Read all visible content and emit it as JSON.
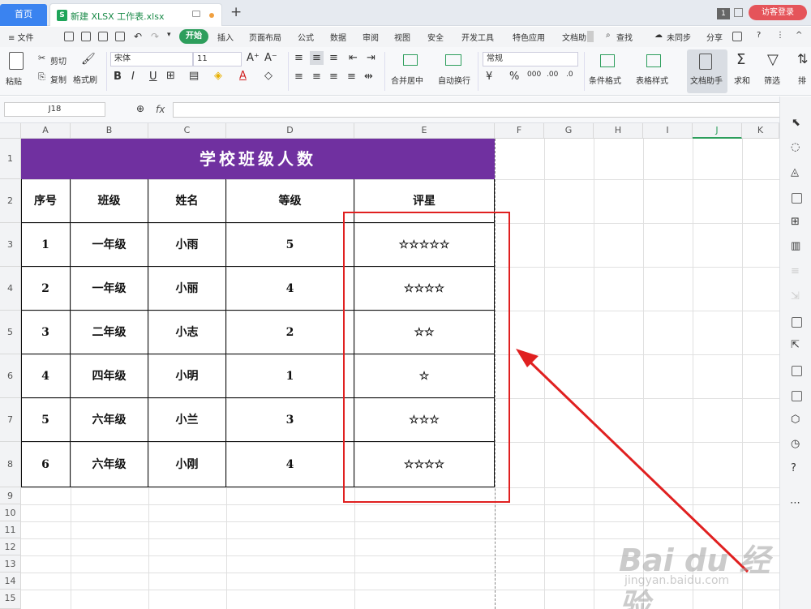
{
  "titlebar": {
    "home_tab": "首页",
    "file_icon": "S",
    "file_name": "新建 XLSX 工作表.xlsx",
    "new_tab": "+",
    "window_badge": "1",
    "login_button": "访客登录"
  },
  "menu": {
    "file": "≡ 文件",
    "start": "开始",
    "items": [
      "插入",
      "页面布局",
      "公式",
      "数据",
      "审阅",
      "视图",
      "安全",
      "开发工具",
      "特色应用",
      "文档助"
    ],
    "search": "查找",
    "sync": "未同步",
    "share": "分享",
    "help": "?",
    "more": "⋮"
  },
  "ribbon": {
    "paste": "粘贴",
    "cut": "剪切",
    "copy": "复制",
    "format_painter": "格式刷",
    "font_name": "宋体",
    "font_size": "11",
    "bold": "B",
    "italic": "I",
    "underline": "U",
    "number_format": "常规",
    "merge_center": "合并居中",
    "wrap_text": "自动换行",
    "percent": "%",
    "cond_format": "条件格式",
    "table_style": "表格样式",
    "doc_assistant": "文档助手",
    "sum": "求和",
    "filter": "筛选",
    "sort": "排"
  },
  "formula_bar": {
    "cell_ref": "J18",
    "fx_label": "fx",
    "content": ""
  },
  "sheet": {
    "columns": [
      "A",
      "B",
      "C",
      "D",
      "E",
      "F",
      "G",
      "H",
      "I",
      "J",
      "K"
    ],
    "rows": [
      "1",
      "2",
      "3",
      "4",
      "5",
      "6",
      "7",
      "8",
      "9",
      "10",
      "11",
      "12",
      "13",
      "14",
      "15"
    ],
    "title": "学校班级人数",
    "headers": [
      "序号",
      "班级",
      "姓名",
      "等级",
      "评星"
    ],
    "data": [
      [
        "1",
        "一年级",
        "小雨",
        "5",
        "☆☆☆☆☆"
      ],
      [
        "2",
        "一年级",
        "小丽",
        "4",
        "☆☆☆☆"
      ],
      [
        "3",
        "二年级",
        "小志",
        "2",
        "☆☆"
      ],
      [
        "4",
        "四年级",
        "小明",
        "1",
        "☆"
      ],
      [
        "5",
        "六年级",
        "小兰",
        "3",
        "☆☆☆"
      ],
      [
        "6",
        "六年级",
        "小刚",
        "4",
        "☆☆☆☆"
      ]
    ],
    "title_color": "#7030a0",
    "highlight_color": "#e02020"
  },
  "watermark": {
    "main": "Bai du 经验",
    "url": "jingyan.baidu.com"
  }
}
